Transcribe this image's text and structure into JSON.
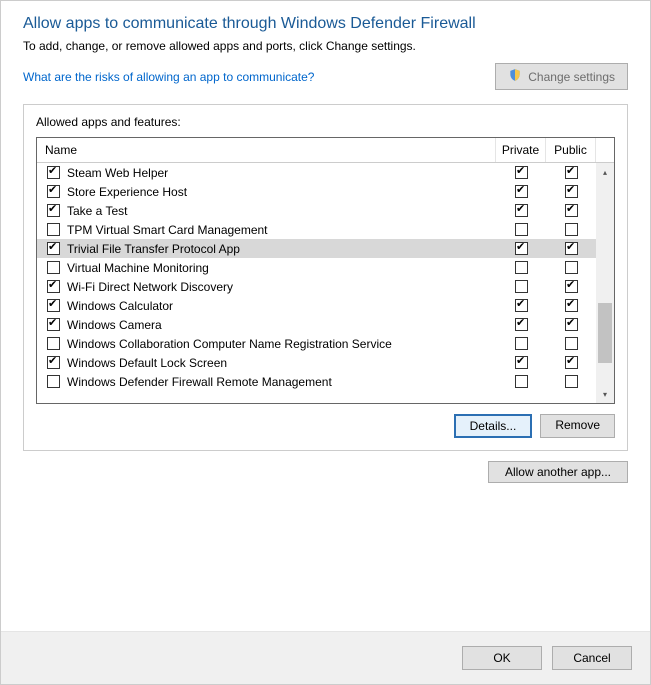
{
  "header": {
    "title": "Allow apps to communicate through Windows Defender Firewall",
    "subtitle": "To add, change, or remove allowed apps and ports, click Change settings.",
    "risk_link": "What are the risks of allowing an app to communicate?",
    "change_settings": "Change settings"
  },
  "panel": {
    "label": "Allowed apps and features:",
    "col_name": "Name",
    "col_private": "Private",
    "col_public": "Public"
  },
  "rows": [
    {
      "name": "Steam Web Helper",
      "allowed": true,
      "private": true,
      "public": true,
      "selected": false
    },
    {
      "name": "Store Experience Host",
      "allowed": true,
      "private": true,
      "public": true,
      "selected": false
    },
    {
      "name": "Take a Test",
      "allowed": true,
      "private": true,
      "public": true,
      "selected": false
    },
    {
      "name": "TPM Virtual Smart Card Management",
      "allowed": false,
      "private": false,
      "public": false,
      "selected": false
    },
    {
      "name": "Trivial File Transfer Protocol App",
      "allowed": true,
      "private": true,
      "public": true,
      "selected": true
    },
    {
      "name": "Virtual Machine Monitoring",
      "allowed": false,
      "private": false,
      "public": false,
      "selected": false
    },
    {
      "name": "Wi-Fi Direct Network Discovery",
      "allowed": true,
      "private": false,
      "public": true,
      "selected": false
    },
    {
      "name": "Windows Calculator",
      "allowed": true,
      "private": true,
      "public": true,
      "selected": false
    },
    {
      "name": "Windows Camera",
      "allowed": true,
      "private": true,
      "public": true,
      "selected": false
    },
    {
      "name": "Windows Collaboration Computer Name Registration Service",
      "allowed": false,
      "private": false,
      "public": false,
      "selected": false
    },
    {
      "name": "Windows Default Lock Screen",
      "allowed": true,
      "private": true,
      "public": true,
      "selected": false
    },
    {
      "name": "Windows Defender Firewall Remote Management",
      "allowed": false,
      "private": false,
      "public": false,
      "selected": false
    }
  ],
  "buttons": {
    "details": "Details...",
    "remove": "Remove",
    "allow_another": "Allow another app...",
    "ok": "OK",
    "cancel": "Cancel"
  }
}
